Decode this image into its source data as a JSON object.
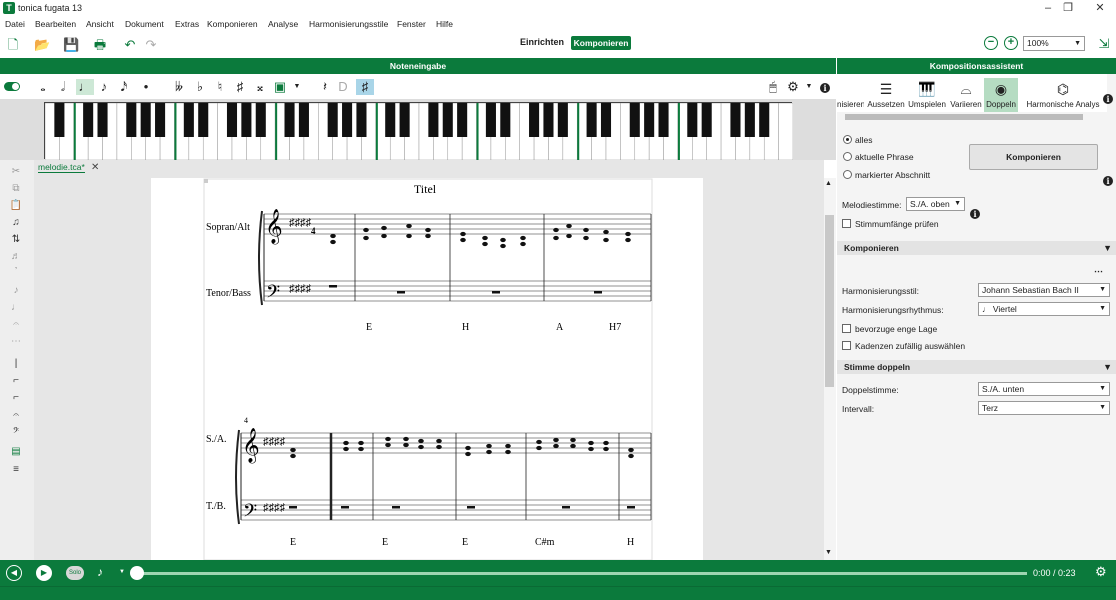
{
  "window": {
    "title": "tonica fugata 13"
  },
  "menu": [
    "Datei",
    "Bearbeiten",
    "Ansicht",
    "Dokument",
    "Extras",
    "Komponieren",
    "Analyse",
    "Harmonisierungsstile",
    "Fenster",
    "Hilfe"
  ],
  "toolbar": {
    "einrichten": "Einrichten",
    "komponieren": "Komponieren",
    "zoom": "100%"
  },
  "panels": {
    "noteneingabe": "Noteneingabe",
    "assistent": "Kompositionsassistent"
  },
  "document": {
    "tab": "melodie.tca*",
    "title": "Titel",
    "staff1": "Sopran/Alt",
    "staff2": "Tenor/Bass",
    "staff3": "S./A.",
    "staff4": "T./B.",
    "measure_number": "4",
    "chords1": [
      "E",
      "H",
      "A",
      "H7"
    ],
    "chords2": [
      "E",
      "E",
      "E",
      "C#m",
      "H"
    ]
  },
  "ribbon": [
    "nisieren",
    "Aussetzen",
    "Umspielen",
    "Variieren",
    "Doppeln",
    "Harmonische Analys"
  ],
  "assistant": {
    "scope": [
      "alles",
      "aktuelle Phrase",
      "markierter Abschnitt"
    ],
    "komp_button": "Komponieren",
    "melodiestimme_label": "Melodiestimme:",
    "melodiestimme_value": "S./A. oben",
    "stimmumfaenge": "Stimmumfänge prüfen",
    "section_komponieren": "Komponieren",
    "stil_label": "Harmonisierungsstil:",
    "stil_value": "Johann Sebastian Bach II",
    "rhythmus_label": "Harmonisierungsrhythmus:",
    "rhythmus_value": "Viertel",
    "enge_lage": "bevorzuge enge Lage",
    "kadenzen": "Kadenzen zufällig auswählen",
    "section_doppeln": "Stimme doppeln",
    "doppel_label": "Doppelstimme:",
    "doppel_value": "S./A. unten",
    "intervall_label": "Intervall:",
    "intervall_value": "Terz"
  },
  "player": {
    "solo": "Solo",
    "time": "0:00 / 0:23"
  },
  "colors": {
    "accent": "#0b7a3c"
  }
}
